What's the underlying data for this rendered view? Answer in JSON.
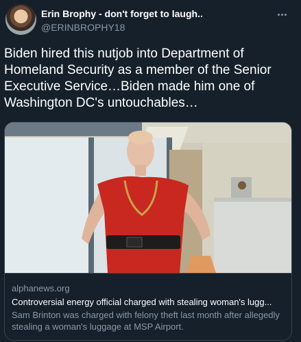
{
  "header": {
    "display_name": "Erin Brophy - don't forget to laugh..",
    "handle": "@ERINBROPHY18",
    "more_icon": "more-horizontal-icon"
  },
  "tweet": {
    "text": "Biden hired this nutjob into Department of Homeland Security as a member of the Senior Executive Service…Biden made him one of Washington DC's untouchables…"
  },
  "card": {
    "domain": "alphanews.org",
    "title": "Controversial energy official charged with stealing woman's lugg...",
    "description": "Sam Brinton was charged with felony theft last month after allegedly stealing a woman's luggage at MSP Airport."
  },
  "colors": {
    "background": "#15202b",
    "secondary_text": "#8b98a5",
    "border": "#38444d",
    "dress": "#c8281f"
  }
}
